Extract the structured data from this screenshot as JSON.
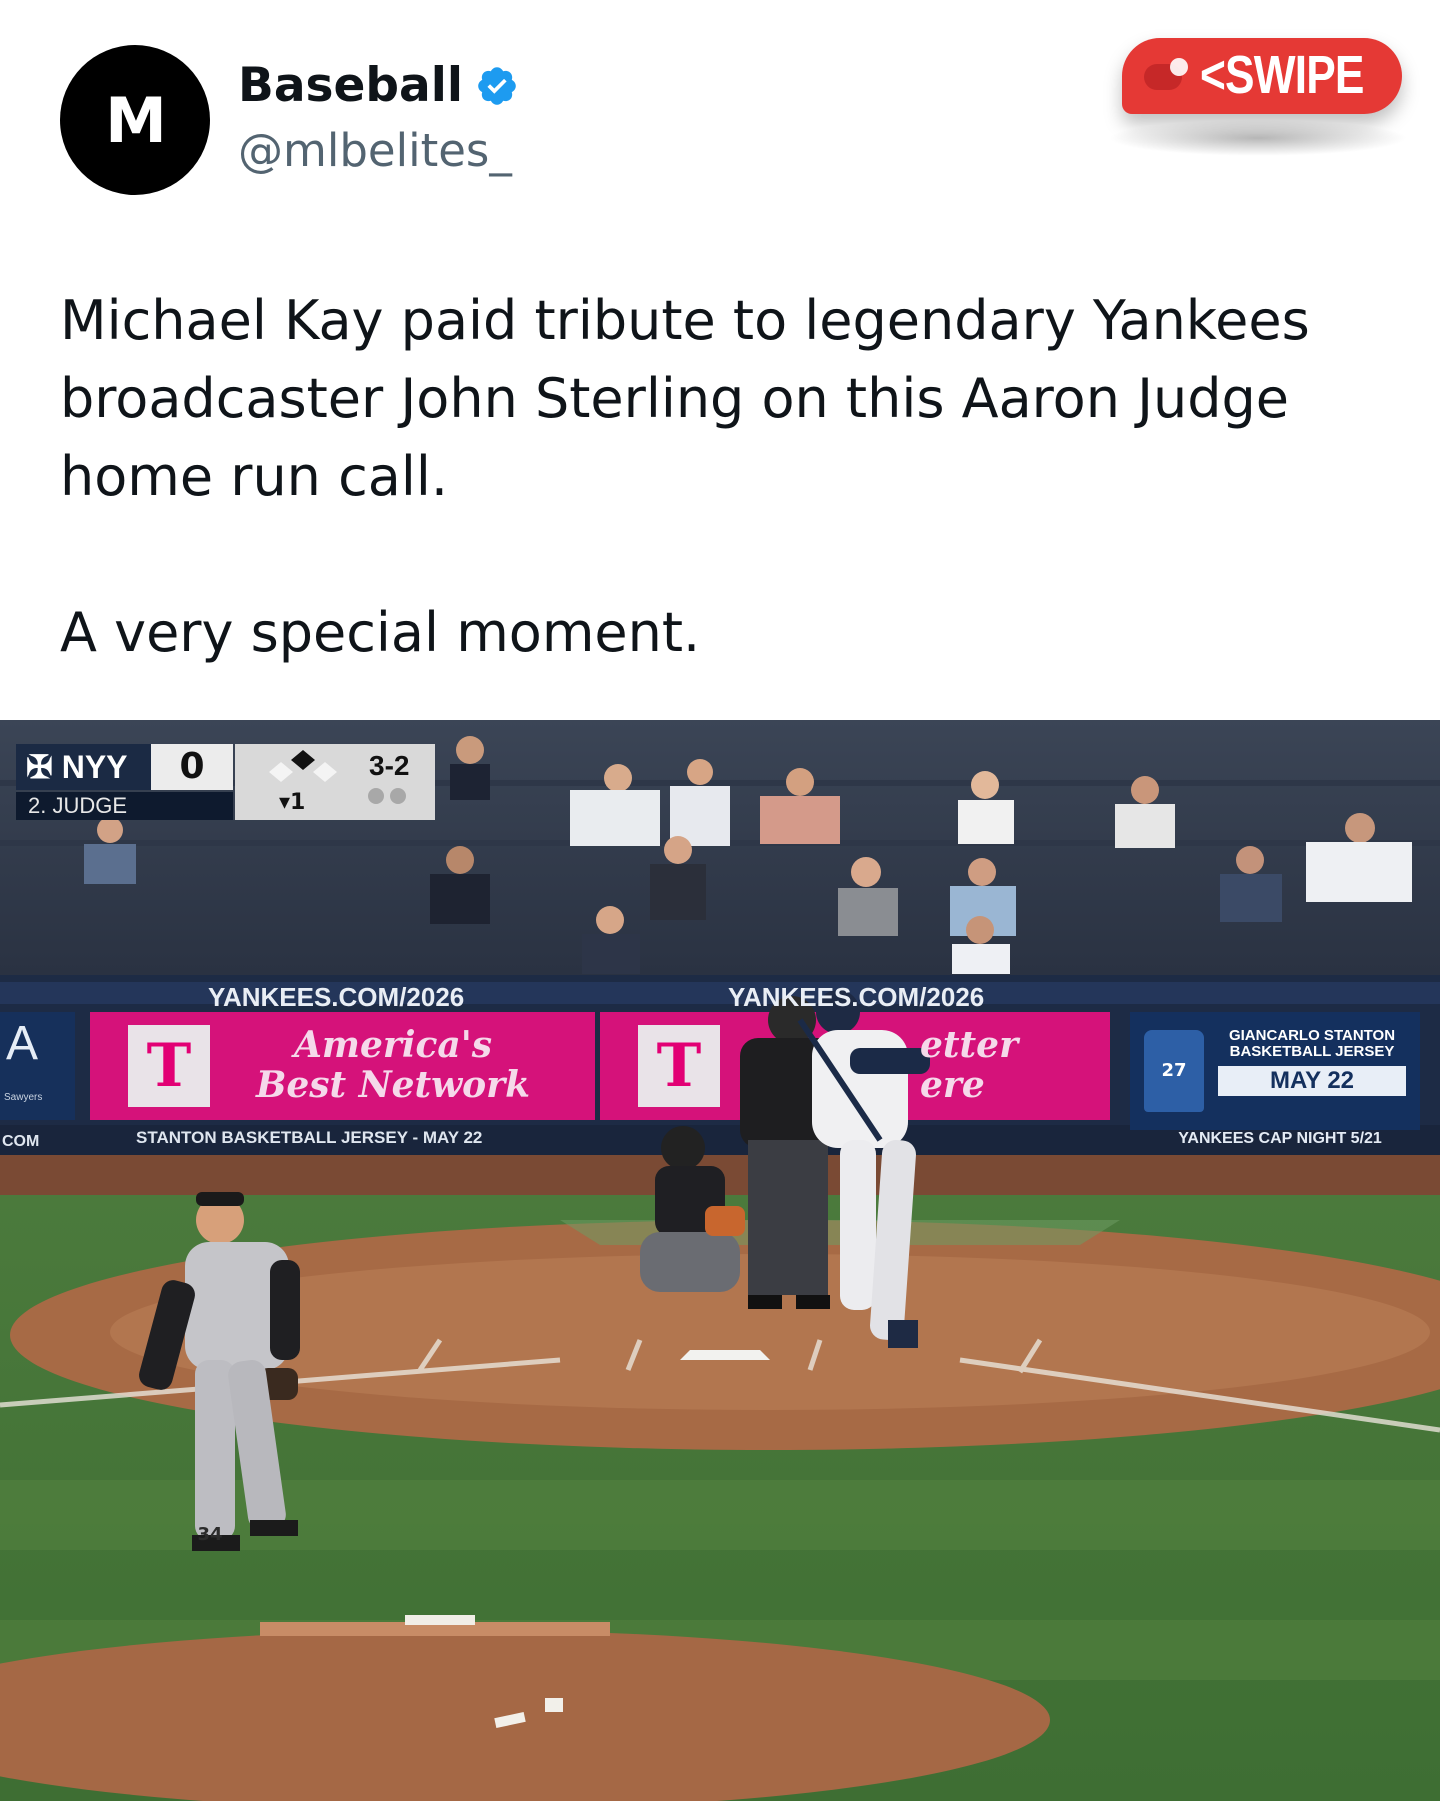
{
  "account": {
    "avatar_letter": "M",
    "display_name": "Baseball",
    "handle": "@mlbelites_",
    "verified": true
  },
  "swipe_badge": {
    "label": "<SWIPE",
    "color": "#e53935"
  },
  "tweet": {
    "paragraph_1": "Michael Kay paid tribute to legendary Yankees broadcaster John Sterling on this Aaron Judge home run call.",
    "paragraph_2": "A very special moment."
  },
  "video": {
    "scorebug": {
      "team": "NYY",
      "score": "0",
      "batter": "2. JUDGE",
      "outs": "1",
      "count": "3-2"
    },
    "ads": {
      "left_url": "YANKEES.COM/2026",
      "center_url": "YANKEES.COM/2026",
      "tmobile_line1": "America's",
      "tmobile_line2": "Best Network",
      "tmobile_partial_1": "etter",
      "tmobile_partial_2": "ere",
      "left_edge_letter": "A",
      "left_edge_small": "COM",
      "left_edge_tiny": "Sawyers",
      "stanton_bottom": "STANTON BASKETBALL JERSEY - MAY 22",
      "stanton_title": "GIANCARLO STANTON BASKETBALL JERSEY",
      "stanton_date": "MAY 22",
      "stanton_jersey_number": "27",
      "cap_night": "YANKEES CAP NIGHT 5/21",
      "tmobile_logo": "T"
    },
    "pitcher_number": "34",
    "colors": {
      "grass": "#4f7a3a",
      "dirt": "#a76a45",
      "tmobile_magenta": "#d5127a",
      "wall_navy": "#1d2b45"
    }
  }
}
